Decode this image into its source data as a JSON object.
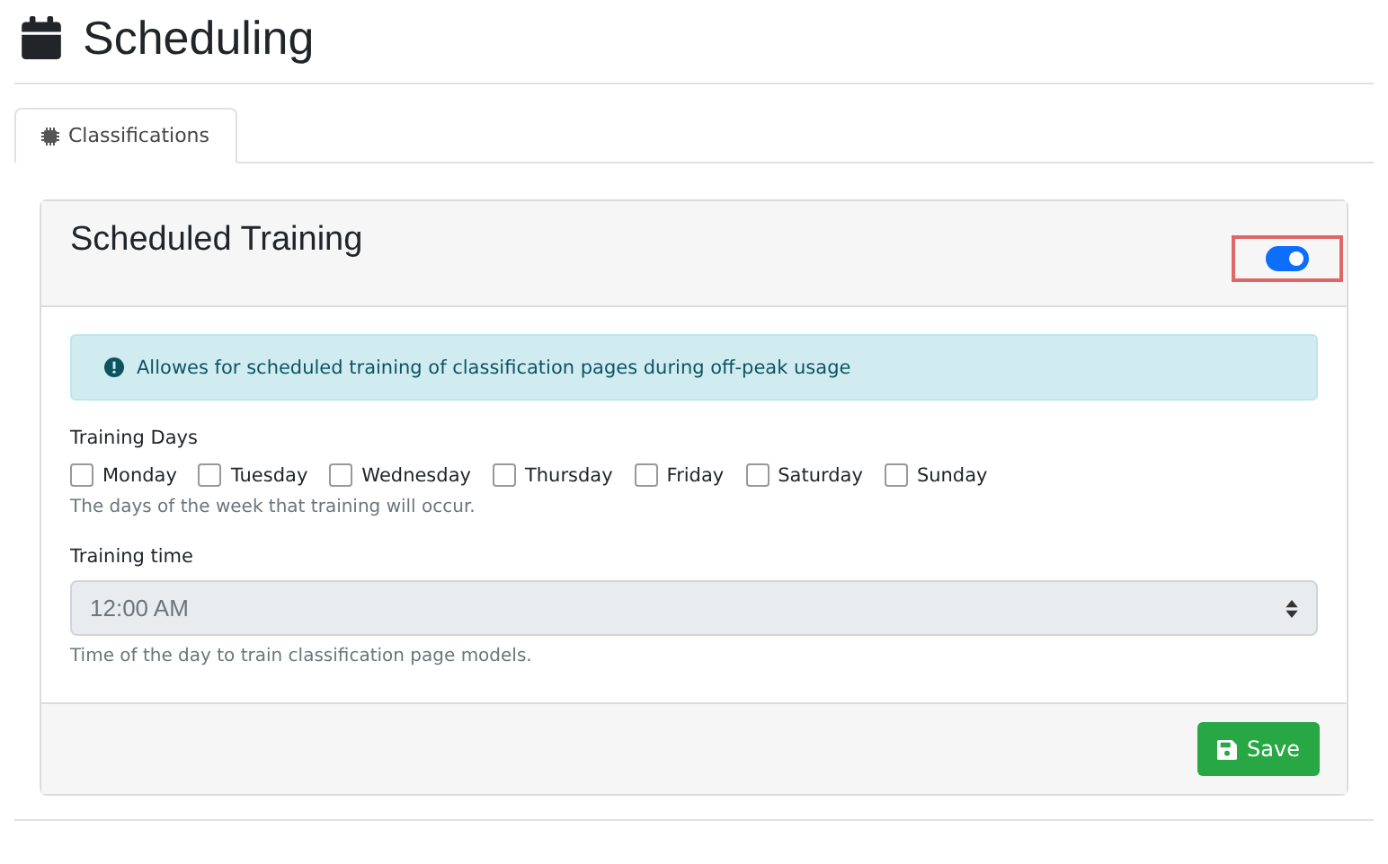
{
  "page": {
    "title": "Scheduling"
  },
  "tabs": [
    {
      "label": "Classifications",
      "selected": true
    }
  ],
  "card": {
    "title": "Scheduled Training",
    "toggle": {
      "on": true,
      "highlighted": true
    },
    "alert": "Allowes for scheduled training of classification pages during off-peak usage",
    "days": {
      "label": "Training Days",
      "help": "The days of the week that training will occur.",
      "options": [
        {
          "label": "Monday",
          "checked": false
        },
        {
          "label": "Tuesday",
          "checked": false
        },
        {
          "label": "Wednesday",
          "checked": false
        },
        {
          "label": "Thursday",
          "checked": false
        },
        {
          "label": "Friday",
          "checked": false
        },
        {
          "label": "Saturday",
          "checked": false
        },
        {
          "label": "Sunday",
          "checked": false
        }
      ]
    },
    "time": {
      "label": "Training time",
      "value": "12:00 AM",
      "disabled": true,
      "help": "Time of the day to train classification page models."
    },
    "buttons": [
      "Save"
    ]
  }
}
